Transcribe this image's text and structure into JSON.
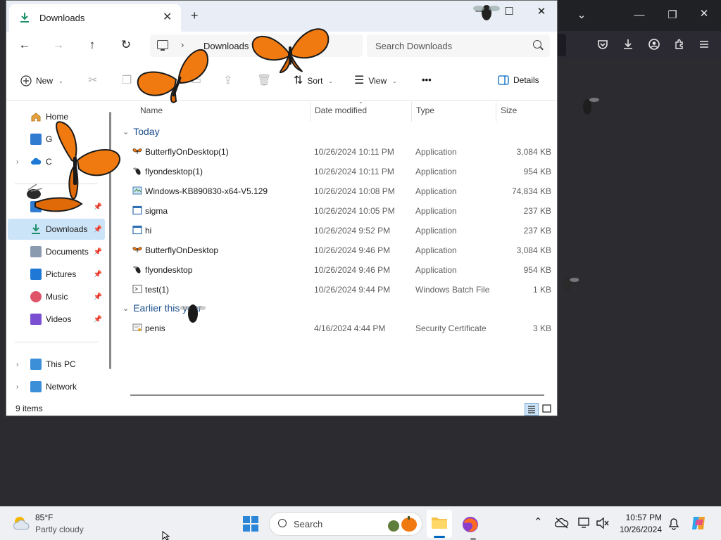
{
  "tab": {
    "title": "Downloads",
    "close": "✕",
    "new": "+"
  },
  "window_controls": {
    "minimize": "—",
    "maximize": "☐",
    "close": "✕"
  },
  "nav": {
    "back": "←",
    "forward": "→",
    "up": "↑",
    "refresh": "↻",
    "breadcrumb": "Downloads",
    "chevron": "›"
  },
  "search": {
    "placeholder": "Search Downloads"
  },
  "toolbar": {
    "new_label": "New",
    "sort_label": "Sort",
    "view_label": "View",
    "more_label": "•••",
    "details_label": "Details"
  },
  "sidebar": {
    "items": [
      {
        "label": "Home"
      },
      {
        "label": "G"
      },
      {
        "label": "C"
      },
      {
        "label": ""
      },
      {
        "label": "Downloads"
      },
      {
        "label": "Documents"
      },
      {
        "label": "Pictures"
      },
      {
        "label": "Music"
      },
      {
        "label": "Videos"
      },
      {
        "label": "This PC"
      },
      {
        "label": "Network"
      }
    ]
  },
  "columns": {
    "name": "Name",
    "date": "Date modified",
    "type": "Type",
    "size": "Size"
  },
  "groups": {
    "today": "Today",
    "earlier": "Earlier this year"
  },
  "files": [
    {
      "name": "ButterflyOnDesktop(1)",
      "date": "10/26/2024 10:11 PM",
      "type": "Application",
      "size": "3,084 KB",
      "icon": "butterfly-icon"
    },
    {
      "name": "flyondesktop(1)",
      "date": "10/26/2024 10:11 PM",
      "type": "Application",
      "size": "954 KB",
      "icon": "fly-icon"
    },
    {
      "name": "Windows-KB890830-x64-V5.129",
      "date": "10/26/2024 10:08 PM",
      "type": "Application",
      "size": "74,834 KB",
      "icon": "installer-icon"
    },
    {
      "name": "sigma",
      "date": "10/26/2024 10:05 PM",
      "type": "Application",
      "size": "237 KB",
      "icon": "app-icon"
    },
    {
      "name": "hi",
      "date": "10/26/2024 9:52 PM",
      "type": "Application",
      "size": "237 KB",
      "icon": "app-icon"
    },
    {
      "name": "ButterflyOnDesktop",
      "date": "10/26/2024 9:46 PM",
      "type": "Application",
      "size": "3,084 KB",
      "icon": "butterfly-icon"
    },
    {
      "name": "flyondesktop",
      "date": "10/26/2024 9:46 PM",
      "type": "Application",
      "size": "954 KB",
      "icon": "fly-icon"
    },
    {
      "name": "test(1)",
      "date": "10/26/2024 9:44 PM",
      "type": "Windows Batch File",
      "size": "1 KB",
      "icon": "batch-file-icon"
    }
  ],
  "earlier_files": [
    {
      "name": "penis",
      "date": "4/16/2024 4:44 PM",
      "type": "Security Certificate",
      "size": "3 KB",
      "icon": "certificate-icon"
    }
  ],
  "status": {
    "item_count": "9 items"
  },
  "taskbar": {
    "weather_temp": "85°F",
    "weather_condition": "Partly cloudy",
    "search_label": "Search",
    "time": "10:57 PM",
    "date": "10/26/2024"
  },
  "colors": {
    "accent": "#0067c0",
    "selection": "#cce4f7",
    "group_header": "#1d4f8c",
    "butterfly": "#f07a10"
  }
}
